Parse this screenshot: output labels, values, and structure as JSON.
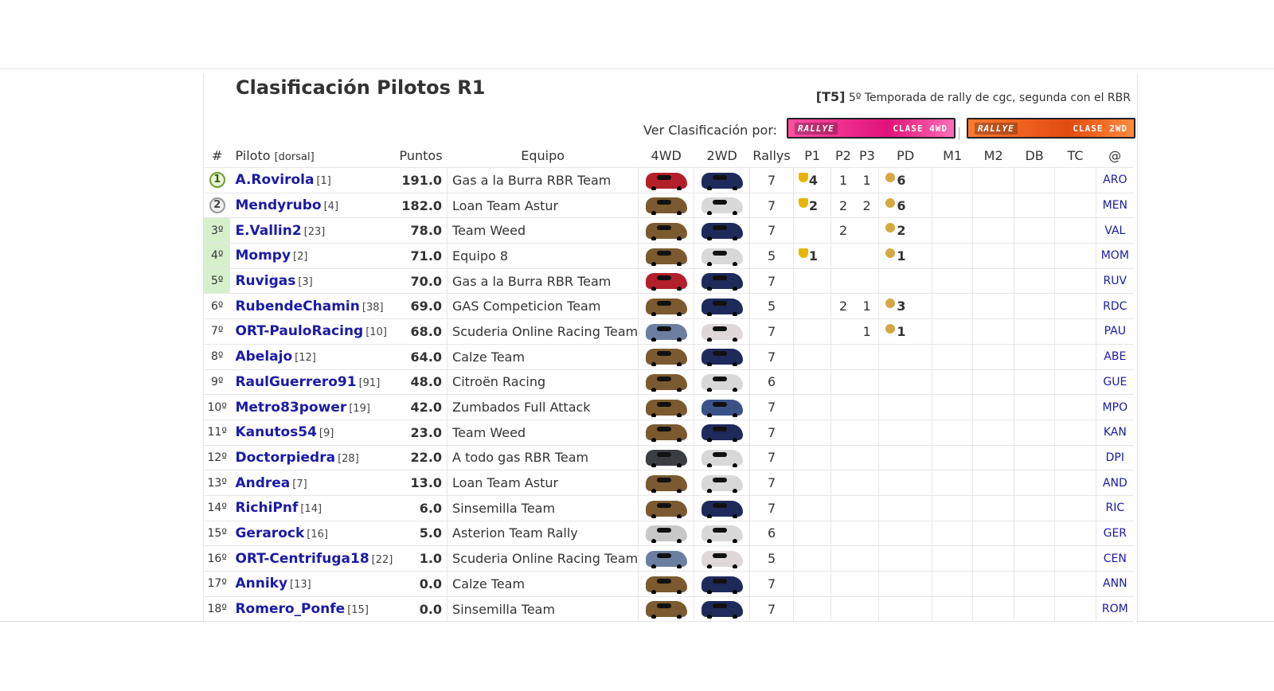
{
  "title": "Clasificación Pilotos R1",
  "season": {
    "tag": "[T5]",
    "text": "5º Temporada de rally de cgc, segunda con el RBR"
  },
  "ver_label": "Ver Clasificación por:",
  "buttons": [
    {
      "left": "RALLYE",
      "right": "CLASE 4WD",
      "color": "#e0137a"
    },
    {
      "left": "RALLYE",
      "right": "CLASE 2WD",
      "color": "#e24b10"
    }
  ],
  "headers": {
    "pos": "#",
    "pilot": "Piloto",
    "pilot_small": "[dorsal]",
    "points": "Puntos",
    "team": "Equipo",
    "c4wd": "4WD",
    "c2wd": "2WD",
    "rallys": "Rallys",
    "p1": "P1",
    "p2": "P2",
    "p3": "P3",
    "pd": "PD",
    "m1": "M1",
    "m2": "M2",
    "db": "DB",
    "tc": "TC",
    "at": "@"
  },
  "rows": [
    {
      "pos": "1",
      "name": "A.Rovirola",
      "dorsal": "[1]",
      "points": "191.0",
      "team": "Gas a la Burra RBR Team",
      "car4": "#b3202a",
      "car2": "#1e2a5a",
      "rallys": "7",
      "p1": "4",
      "p2": "1",
      "p3": "1",
      "pd": "6",
      "code": "ARO"
    },
    {
      "pos": "2",
      "name": "Mendyrubo",
      "dorsal": "[4]",
      "points": "182.0",
      "team": "Loan Team Astur",
      "car4": "#7a5a2e",
      "car2": "#d8d8d8",
      "rallys": "7",
      "p1": "2",
      "p2": "2",
      "p3": "2",
      "pd": "6",
      "code": "MEN"
    },
    {
      "pos": "3º",
      "name": "E.Vallin2",
      "dorsal": "[23]",
      "points": "78.0",
      "team": "Team Weed",
      "car4": "#7a5a2e",
      "car2": "#1e2a5a",
      "rallys": "7",
      "p1": "",
      "p2": "2",
      "p3": "",
      "pd": "2",
      "code": "VAL"
    },
    {
      "pos": "4º",
      "name": "Mompy",
      "dorsal": "[2]",
      "points": "71.0",
      "team": "Equipo 8",
      "car4": "#7a5a2e",
      "car2": "#d8d8d8",
      "rallys": "5",
      "p1": "1",
      "p2": "",
      "p3": "",
      "pd": "1",
      "code": "MOM"
    },
    {
      "pos": "5º",
      "name": "Ruvigas",
      "dorsal": "[3]",
      "points": "70.0",
      "team": "Gas a la Burra RBR Team",
      "car4": "#b3202a",
      "car2": "#1e2a5a",
      "rallys": "7",
      "p1": "",
      "p2": "",
      "p3": "",
      "pd": "",
      "code": "RUV"
    },
    {
      "pos": "6º",
      "name": "RubendeChamin",
      "dorsal": "[38]",
      "points": "69.0",
      "team": "GAS Competicion Team",
      "car4": "#7a5a2e",
      "car2": "#1e2a5a",
      "rallys": "5",
      "p1": "",
      "p2": "2",
      "p3": "1",
      "pd": "3",
      "code": "RDC"
    },
    {
      "pos": "7º",
      "name": "ORT-PauloRacing",
      "dorsal": "[10]",
      "points": "68.0",
      "team": "Scuderia Online Racing Team",
      "car4": "#6d7fa0",
      "car2": "#e0d8d8",
      "rallys": "7",
      "p1": "",
      "p2": "",
      "p3": "1",
      "pd": "1",
      "code": "PAU"
    },
    {
      "pos": "8º",
      "name": "Abelajo",
      "dorsal": "[12]",
      "points": "64.0",
      "team": "Calze Team",
      "car4": "#7a5a2e",
      "car2": "#1e2a5a",
      "rallys": "7",
      "p1": "",
      "p2": "",
      "p3": "",
      "pd": "",
      "code": "ABE"
    },
    {
      "pos": "9º",
      "name": "RaulGuerrero91",
      "dorsal": "[91]",
      "points": "48.0",
      "team": "Citroën Racing",
      "car4": "#7a5a2e",
      "car2": "#d8d8d8",
      "rallys": "6",
      "p1": "",
      "p2": "",
      "p3": "",
      "pd": "",
      "code": "GUE"
    },
    {
      "pos": "10º",
      "name": "Metro83power",
      "dorsal": "[19]",
      "points": "42.0",
      "team": "Zumbados Full Attack",
      "car4": "#7a5a2e",
      "car2": "#3b5288",
      "rallys": "7",
      "p1": "",
      "p2": "",
      "p3": "",
      "pd": "",
      "code": "MPO"
    },
    {
      "pos": "11º",
      "name": "Kanutos54",
      "dorsal": "[9]",
      "points": "23.0",
      "team": "Team Weed",
      "car4": "#7a5a2e",
      "car2": "#1e2a5a",
      "rallys": "7",
      "p1": "",
      "p2": "",
      "p3": "",
      "pd": "",
      "code": "KAN"
    },
    {
      "pos": "12º",
      "name": "Doctorpiedra",
      "dorsal": "[28]",
      "points": "22.0",
      "team": "A todo gas RBR Team",
      "car4": "#3a3d44",
      "car2": "#d8d8d8",
      "rallys": "7",
      "p1": "",
      "p2": "",
      "p3": "",
      "pd": "",
      "code": "DPI"
    },
    {
      "pos": "13º",
      "name": "Andrea",
      "dorsal": "[7]",
      "points": "13.0",
      "team": "Loan Team Astur",
      "car4": "#7a5a2e",
      "car2": "#d8d8d8",
      "rallys": "7",
      "p1": "",
      "p2": "",
      "p3": "",
      "pd": "",
      "code": "AND"
    },
    {
      "pos": "14º",
      "name": "RichiPnf",
      "dorsal": "[14]",
      "points": "6.0",
      "team": "Sinsemilla Team",
      "car4": "#7a5a2e",
      "car2": "#1e2a5a",
      "rallys": "7",
      "p1": "",
      "p2": "",
      "p3": "",
      "pd": "",
      "code": "RIC"
    },
    {
      "pos": "15º",
      "name": "Gerarock",
      "dorsal": "[16]",
      "points": "5.0",
      "team": "Asterion Team Rally",
      "car4": "#c8c8c8",
      "car2": "#d8d8d8",
      "rallys": "6",
      "p1": "",
      "p2": "",
      "p3": "",
      "pd": "",
      "code": "GER"
    },
    {
      "pos": "16º",
      "name": "ORT-Centrifuga18",
      "dorsal": "[22]",
      "points": "1.0",
      "team": "Scuderia Online Racing Team",
      "car4": "#6d7fa0",
      "car2": "#e0d8d8",
      "rallys": "5",
      "p1": "",
      "p2": "",
      "p3": "",
      "pd": "",
      "code": "CEN"
    },
    {
      "pos": "17º",
      "name": "Anniky",
      "dorsal": "[13]",
      "points": "0.0",
      "team": "Calze Team",
      "car4": "#7a5a2e",
      "car2": "#1e2a5a",
      "rallys": "7",
      "p1": "",
      "p2": "",
      "p3": "",
      "pd": "",
      "code": "ANN"
    },
    {
      "pos": "18º",
      "name": "Romero_Ponfe",
      "dorsal": "[15]",
      "points": "0.0",
      "team": "Sinsemilla Team",
      "car4": "#7a5a2e",
      "car2": "#1e2a5a",
      "rallys": "7",
      "p1": "",
      "p2": "",
      "p3": "",
      "pd": "",
      "code": "ROM"
    }
  ]
}
